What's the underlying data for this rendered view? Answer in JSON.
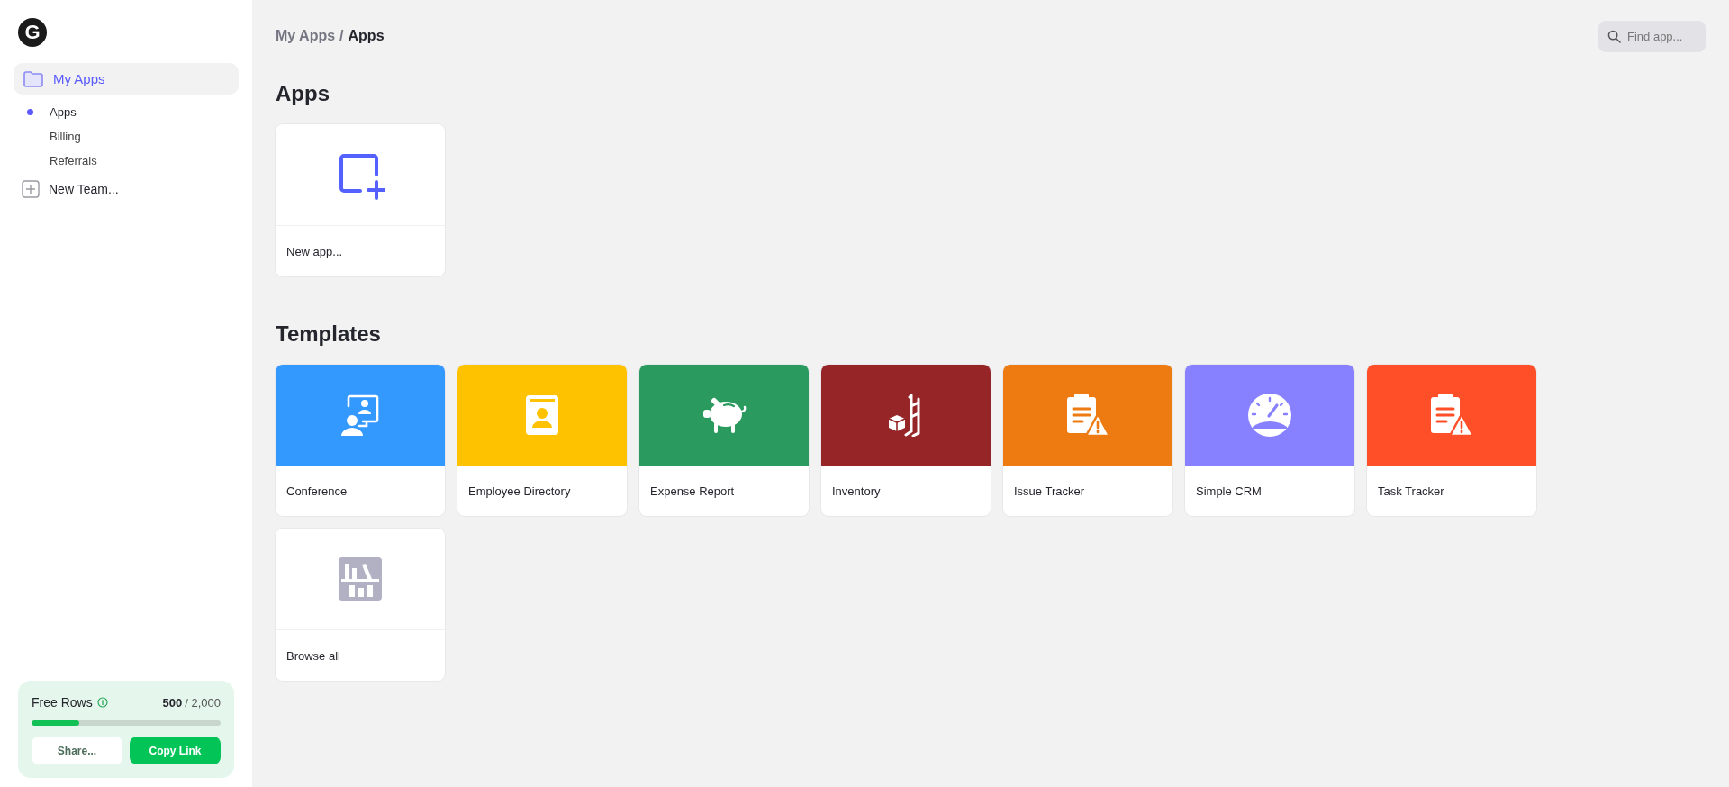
{
  "sidebar": {
    "logo": "G",
    "nav": {
      "label": "My Apps",
      "selected": true,
      "children": [
        {
          "label": "Apps",
          "selected": true
        },
        {
          "label": "Billing",
          "selected": false
        },
        {
          "label": "Referrals",
          "selected": false
        }
      ]
    },
    "new_team": "New Team...",
    "usage": {
      "label": "Free Rows",
      "used": "500",
      "total": "/ 2,000",
      "level": 0.25,
      "buttons": [
        "Share...",
        "Copy Link"
      ]
    }
  },
  "breadcrumb": {
    "parent": "My Apps",
    "separator": "/",
    "current": "Apps"
  },
  "search": {
    "placeholder": "Find app..."
  },
  "apps": {
    "title": "Apps",
    "items": [
      {
        "label": "New app..."
      }
    ]
  },
  "templates": {
    "title": "Templates",
    "items": [
      {
        "label": "Conference",
        "kind": "conference",
        "color": "#3399ff"
      },
      {
        "label": "Employee Directory",
        "kind": "directory",
        "color": "#ffc200"
      },
      {
        "label": "Expense Report",
        "kind": "expense",
        "color": "#2a9a5e"
      },
      {
        "label": "Inventory",
        "kind": "inventory",
        "color": "#962527"
      },
      {
        "label": "Issue Tracker",
        "kind": "clipboard",
        "color": "#ee7a12"
      },
      {
        "label": "Simple CRM",
        "kind": "crm",
        "color": "#8780ff"
      },
      {
        "label": "Task Tracker",
        "kind": "clipboard",
        "color": "#ff4f29"
      }
    ],
    "browse": {
      "label": "Browse all"
    }
  }
}
